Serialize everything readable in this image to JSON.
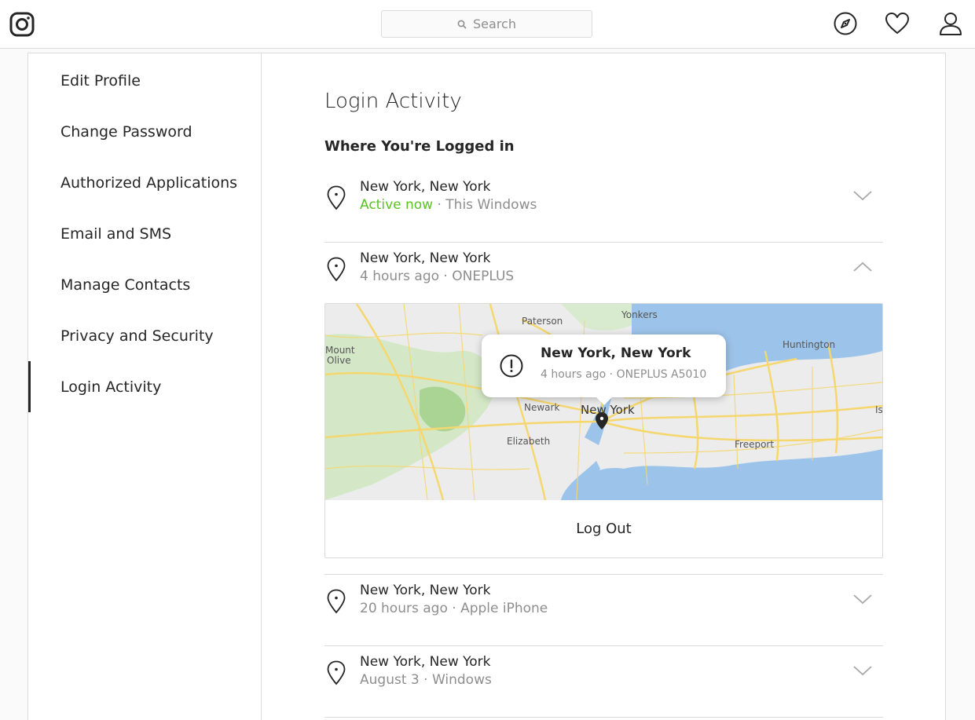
{
  "header": {
    "search_placeholder": "Search",
    "icons": [
      "instagram-logo-icon",
      "search-icon",
      "explore-compass-icon",
      "activity-heart-icon",
      "profile-icon"
    ]
  },
  "sidebar": {
    "items": [
      {
        "label": "Edit Profile"
      },
      {
        "label": "Change Password"
      },
      {
        "label": "Authorized Applications"
      },
      {
        "label": "Email and SMS"
      },
      {
        "label": "Manage Contacts"
      },
      {
        "label": "Privacy and Security"
      },
      {
        "label": "Login Activity",
        "active": true
      }
    ]
  },
  "main": {
    "title": "Login Activity",
    "section_title": "Where You're Logged in",
    "sessions": [
      {
        "location": "New York, New York",
        "status": "Active now",
        "separator": " · ",
        "device": "This Windows",
        "expanded": false
      },
      {
        "location": "New York, New York",
        "status": "4 hours ago",
        "separator": " · ",
        "device": "ONEPLUS",
        "expanded": true
      },
      {
        "location": "New York, New York",
        "status": "20 hours ago",
        "separator": " · ",
        "device": "Apple iPhone",
        "expanded": false
      },
      {
        "location": "New York, New York",
        "status": "August 3",
        "separator": " · ",
        "device": "Windows",
        "expanded": false
      }
    ],
    "popup": {
      "location": "New York, New York",
      "time": "4 hours ago",
      "separator": " · ",
      "device": "ONEPLUS A5010"
    },
    "logout_label": "Log Out",
    "map_labels": {
      "paterson": "Paterson",
      "yonkers": "Yonkers",
      "huntington": "Huntington",
      "mount": "Mount",
      "olive": "Olive",
      "newark": "Newark",
      "new_york": "New York",
      "elizabeth": "Elizabeth",
      "freeport": "Freeport",
      "is": "Is"
    }
  },
  "colors": {
    "active_now": "#58c322",
    "border": "#dbdbdb",
    "text_primary": "#262626",
    "text_secondary": "#8e8e8e",
    "map_water": "#9cc3ea",
    "map_road": "#f5d76e"
  }
}
